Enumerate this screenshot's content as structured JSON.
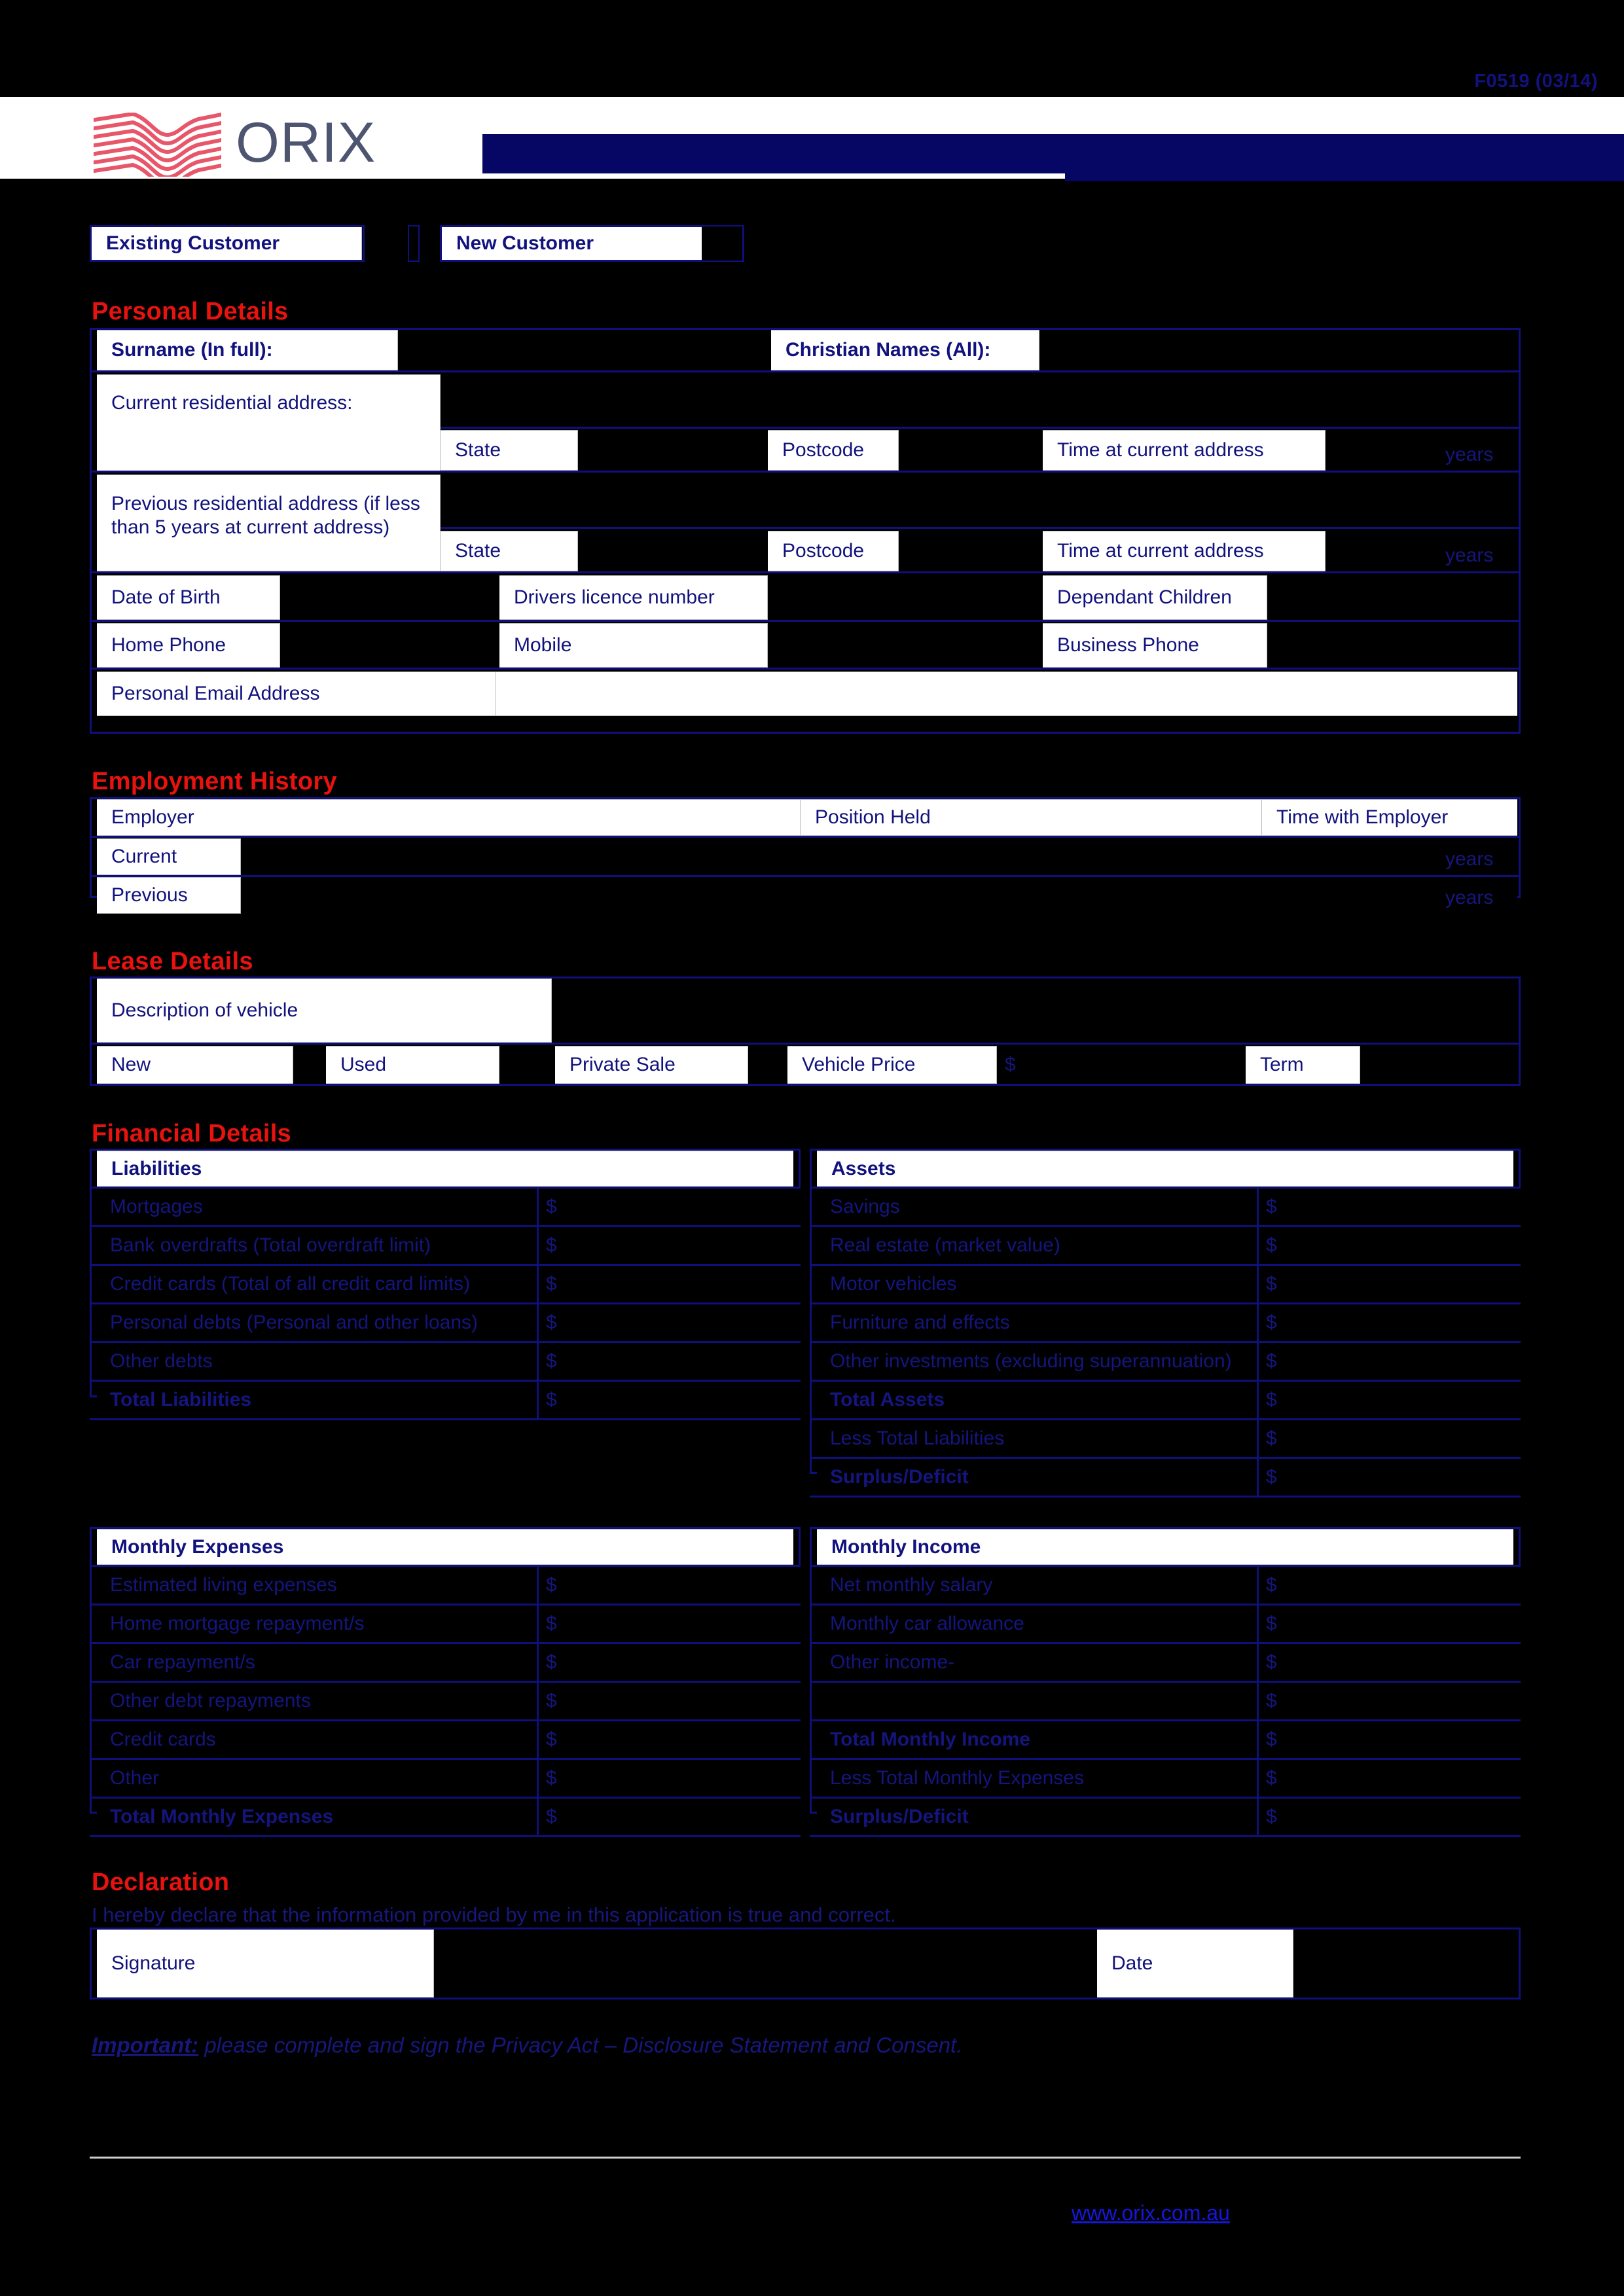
{
  "header": {
    "form_code": "F0519 (03/14)",
    "logo_text": "ORIX",
    "logo_icon": "orix-wave-logo"
  },
  "customer_type": {
    "existing_label": "Existing Customer",
    "new_label": "New Customer"
  },
  "sections": {
    "personal": "Personal Details",
    "employment": "Employment History",
    "lease": "Lease Details",
    "financial": "Financial Details",
    "declaration": "Declaration"
  },
  "personal": {
    "surname_label": "Surname (In full):",
    "christian_names_label": "Christian Names (All):",
    "current_address_label": "Current residential address:",
    "previous_address_label": "Previous residential address (if less than 5 years at current address)",
    "state_label": "State",
    "postcode_label": "Postcode",
    "time_at_address_label": "Time at current address",
    "years_label": "years",
    "dob_label": "Date of Birth",
    "licence_label": "Drivers licence number",
    "dependants_label": "Dependant Children",
    "home_phone_label": "Home Phone",
    "mobile_label": "Mobile",
    "business_phone_label": "Business Phone",
    "email_label": "Personal Email Address"
  },
  "employment": {
    "employer_header": "Employer",
    "position_header": "Position Held",
    "time_header": "Time with Employer",
    "rows": [
      {
        "label": "Current",
        "years": "years"
      },
      {
        "label": "Previous",
        "years": "years"
      }
    ]
  },
  "lease": {
    "description_label": "Description of vehicle",
    "new_label": "New",
    "used_label": "Used",
    "private_sale_label": "Private Sale",
    "vehicle_price_label": "Vehicle Price",
    "currency": "$",
    "term_label": "Term"
  },
  "financial": {
    "liabilities_header": "Liabilities",
    "assets_header": "Assets",
    "currency": "$",
    "liabilities": [
      {
        "label": "Mortgages",
        "bold": false
      },
      {
        "label": "Bank overdrafts (Total overdraft limit)",
        "bold": false
      },
      {
        "label": "Credit cards (Total of all credit card limits)",
        "bold": false
      },
      {
        "label": "Personal debts (Personal and other loans)",
        "bold": false
      },
      {
        "label": "Other debts",
        "bold": false
      },
      {
        "label": "Total Liabilities",
        "bold": true
      }
    ],
    "assets": [
      {
        "label": "Savings",
        "bold": false
      },
      {
        "label": "Real estate (market value)",
        "bold": false
      },
      {
        "label": "Motor vehicles",
        "bold": false
      },
      {
        "label": "Furniture and effects",
        "bold": false
      },
      {
        "label": "Other investments (excluding superannuation)",
        "bold": false
      },
      {
        "label": "Total Assets",
        "bold": true
      },
      {
        "label": "Less Total Liabilities",
        "bold": false
      },
      {
        "label": "Surplus/Deficit",
        "bold": true
      }
    ],
    "expenses_header": "Monthly Expenses",
    "income_header": "Monthly Income",
    "expenses": [
      {
        "label": "Estimated living expenses",
        "bold": false
      },
      {
        "label": "Home mortgage repayment/s",
        "bold": false
      },
      {
        "label": "Car repayment/s",
        "bold": false
      },
      {
        "label": "Other debt repayments",
        "bold": false
      },
      {
        "label": "Credit cards",
        "bold": false
      },
      {
        "label": "Other",
        "bold": false
      },
      {
        "label": "Total Monthly Expenses",
        "bold": true
      }
    ],
    "income": [
      {
        "label": "Net monthly salary",
        "bold": false
      },
      {
        "label": "Monthly car allowance",
        "bold": false
      },
      {
        "label": "Other income-",
        "bold": false
      },
      {
        "label": "",
        "bold": false
      },
      {
        "label": "Total Monthly Income",
        "bold": true
      },
      {
        "label": "Less Total Monthly Expenses",
        "bold": false
      },
      {
        "label": "Surplus/Deficit",
        "bold": true
      }
    ]
  },
  "declaration": {
    "body": "I hereby declare that the information provided by me in this application is true and correct.",
    "signature_label": "Signature",
    "date_label": "Date",
    "important_prefix": "Important:",
    "important_text": " please complete and sign the Privacy Act – Disclosure Statement and Consent."
  },
  "footer": {
    "url": "www.orix.com.au"
  }
}
